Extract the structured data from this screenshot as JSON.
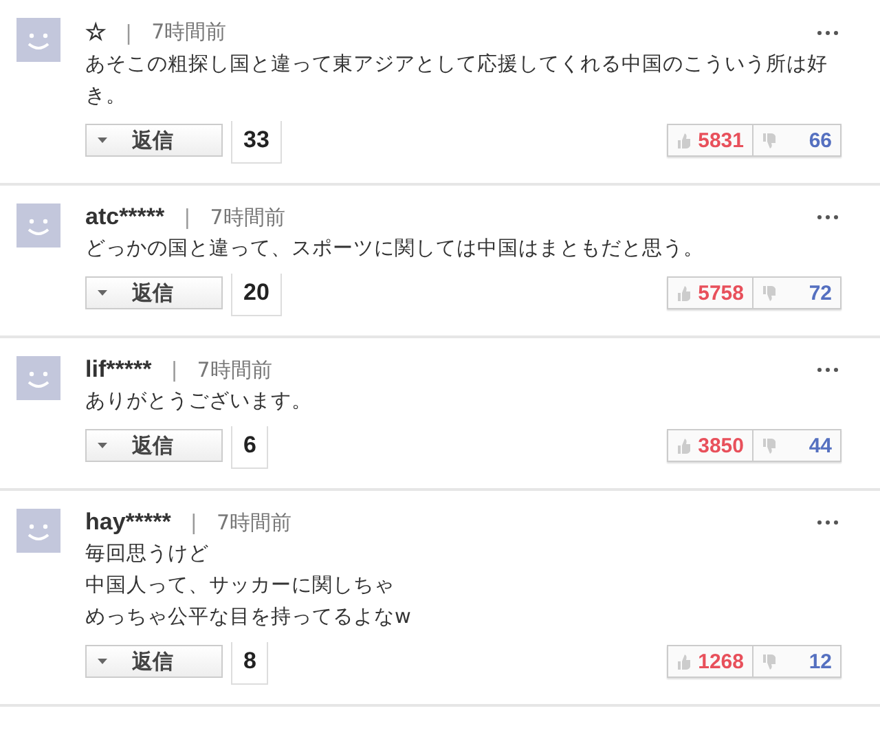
{
  "comments": [
    {
      "author": "☆",
      "separator": "|",
      "time": "7時間前",
      "lines": [
        "あそこの粗探し国と違って東アジアとして応援してくれる中国のこういう所は好き。"
      ],
      "reply_label": "返信",
      "reply_count": "33",
      "likes": "5831",
      "dislikes": "66"
    },
    {
      "author": "atc*****",
      "separator": "|",
      "time": "7時間前",
      "lines": [
        "どっかの国と違って、スポーツに関しては中国はまともだと思う。"
      ],
      "reply_label": "返信",
      "reply_count": "20",
      "likes": "5758",
      "dislikes": "72"
    },
    {
      "author": "lif*****",
      "separator": "|",
      "time": "7時間前",
      "lines": [
        "ありがとうございます。"
      ],
      "reply_label": "返信",
      "reply_count": "6",
      "likes": "3850",
      "dislikes": "44"
    },
    {
      "author": "hay*****",
      "separator": "|",
      "time": "7時間前",
      "lines": [
        "毎回思うけど",
        "中国人って、サッカーに関しちゃ",
        "めっちゃ公平な目を持ってるよなw"
      ],
      "reply_label": "返信",
      "reply_count": "8",
      "likes": "1268",
      "dislikes": "12"
    }
  ]
}
